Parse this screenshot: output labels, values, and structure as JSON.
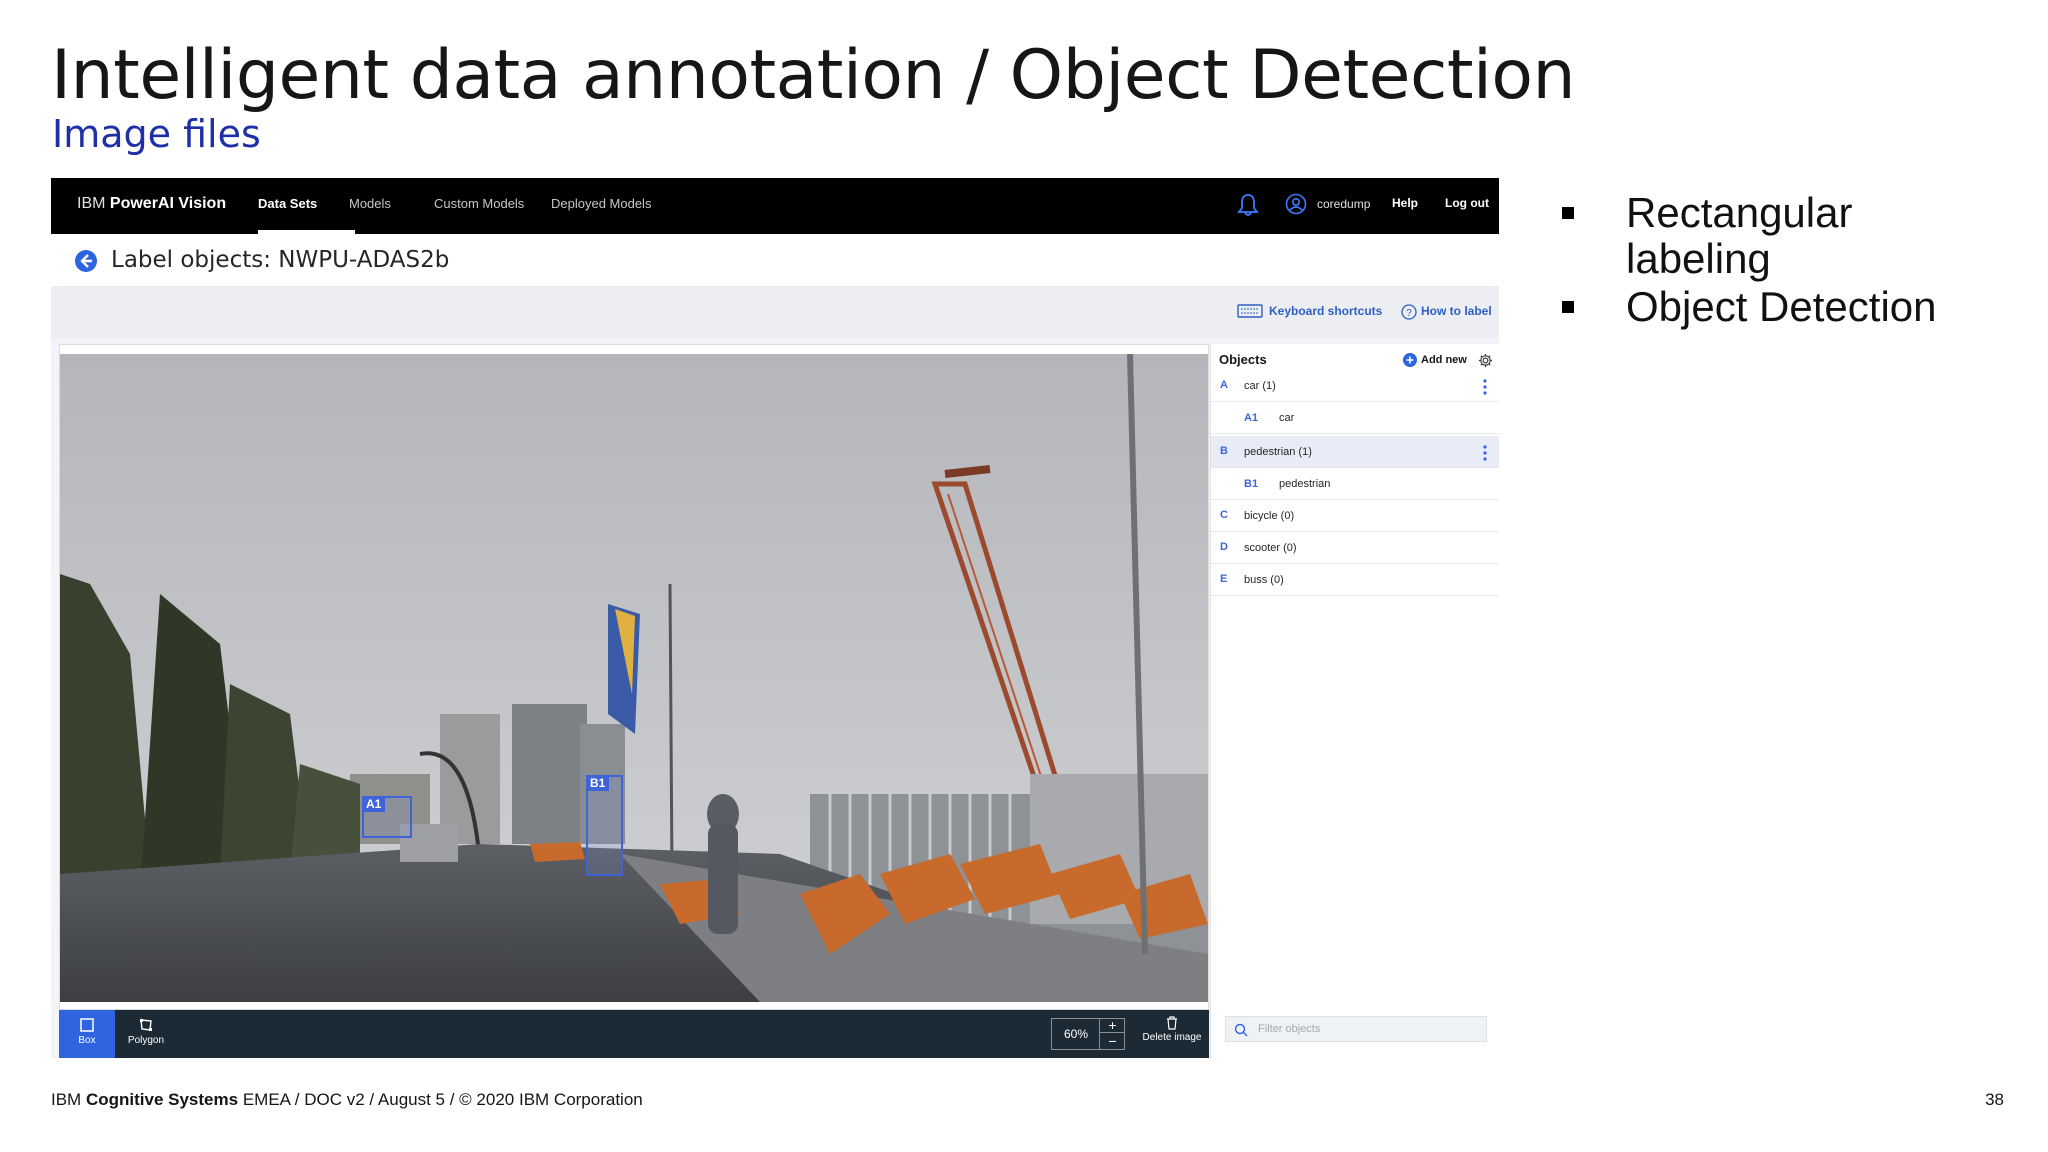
{
  "slide": {
    "title": "Intelligent data annotation / Object Detection",
    "subtitle": "Image files",
    "bullets": [
      "Rectangular labeling",
      "Object Detection"
    ],
    "footer_brand_ibm": "IBM",
    "footer_brand_bold": "Cognitive Systems",
    "footer_rest": "EMEA / DOC v2 / August 5 / © 2020 IBM Corporation",
    "page_number": "38"
  },
  "app": {
    "brand_prefix": "IBM",
    "brand_name": "PowerAI Vision",
    "nav": [
      "Data Sets",
      "Models",
      "Custom Models",
      "Deployed Models"
    ],
    "user": "coredump",
    "help": "Help",
    "logout": "Log out",
    "page_heading": "Label objects: NWPU-ADAS2b",
    "keyboard_shortcuts": "Keyboard shortcuts",
    "how_to_label": "How to label",
    "annotations": [
      {
        "tag": "A1",
        "label": "car"
      },
      {
        "tag": "B1",
        "label": "pedestrian"
      }
    ],
    "tools": {
      "box": "Box",
      "polygon": "Polygon"
    },
    "zoom": "60%",
    "zoom_plus": "+",
    "zoom_minus": "−",
    "delete_image": "Delete image",
    "objects_panel": {
      "heading": "Objects",
      "add_new": "Add new",
      "filter_placeholder": "Filter objects",
      "rows": [
        {
          "key": "A",
          "name": "car (1)",
          "sub": {
            "key": "A1",
            "name": "car"
          }
        },
        {
          "key": "B",
          "name": "pedestrian (1)",
          "sub": {
            "key": "B1",
            "name": "pedestrian"
          }
        },
        {
          "key": "C",
          "name": "bicycle (0)"
        },
        {
          "key": "D",
          "name": "scooter (0)"
        },
        {
          "key": "E",
          "name": "buss (0)"
        }
      ]
    },
    "colors": {
      "accent": "#3f64d8",
      "navbar": "#000000",
      "toolbar": "#1c2a36",
      "active_tool": "#2f64e0"
    },
    "icons": [
      "bell-icon",
      "user-icon",
      "back-arrow-icon",
      "keyboard-icon",
      "help-circle-icon",
      "add-icon",
      "gear-icon",
      "kebab-icon",
      "box-icon",
      "polygon-icon",
      "trash-icon",
      "search-icon"
    ]
  }
}
